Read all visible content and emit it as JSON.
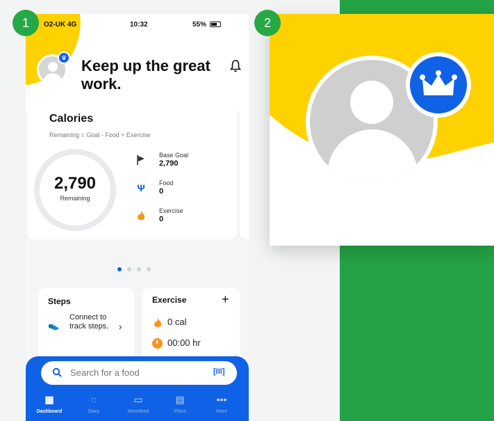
{
  "status_bar": {
    "carrier": "O2-UK 4G",
    "time": "10:32",
    "battery": "55%"
  },
  "header": {
    "title": "Keep up the great work."
  },
  "calories": {
    "title": "Calories",
    "formula": "Remaining = Goal - Food + Exercise",
    "remaining_value": "2,790",
    "remaining_label": "Remaining",
    "stats": [
      {
        "label": "Base Goal",
        "value": "2,790",
        "icon": "flag-icon"
      },
      {
        "label": "Food",
        "value": "0",
        "icon": "fork-knife-icon"
      },
      {
        "label": "Exercise",
        "value": "0",
        "icon": "flame-icon"
      }
    ]
  },
  "pager": {
    "count": 4,
    "active_index": 0
  },
  "steps": {
    "title": "Steps",
    "connect_text": "Connect to track steps."
  },
  "exercise": {
    "title": "Exercise",
    "calories": "0 cal",
    "duration": "00:00 hr"
  },
  "search": {
    "placeholder": "Search for a food"
  },
  "tabs": [
    {
      "label": "Dashboard",
      "icon": "dashboard-icon",
      "active": true
    },
    {
      "label": "Diary",
      "icon": "diary-icon",
      "active": false
    },
    {
      "label": "Newsfeed",
      "icon": "newsfeed-icon",
      "active": false
    },
    {
      "label": "Plans",
      "icon": "plans-icon",
      "active": false
    },
    {
      "label": "More",
      "icon": "more-icon",
      "active": false
    }
  ],
  "callouts": [
    "1",
    "2"
  ],
  "colors": {
    "brand_blue": "#0f62e5",
    "accent_yellow": "#fdd200",
    "callout_green": "#27a847"
  }
}
